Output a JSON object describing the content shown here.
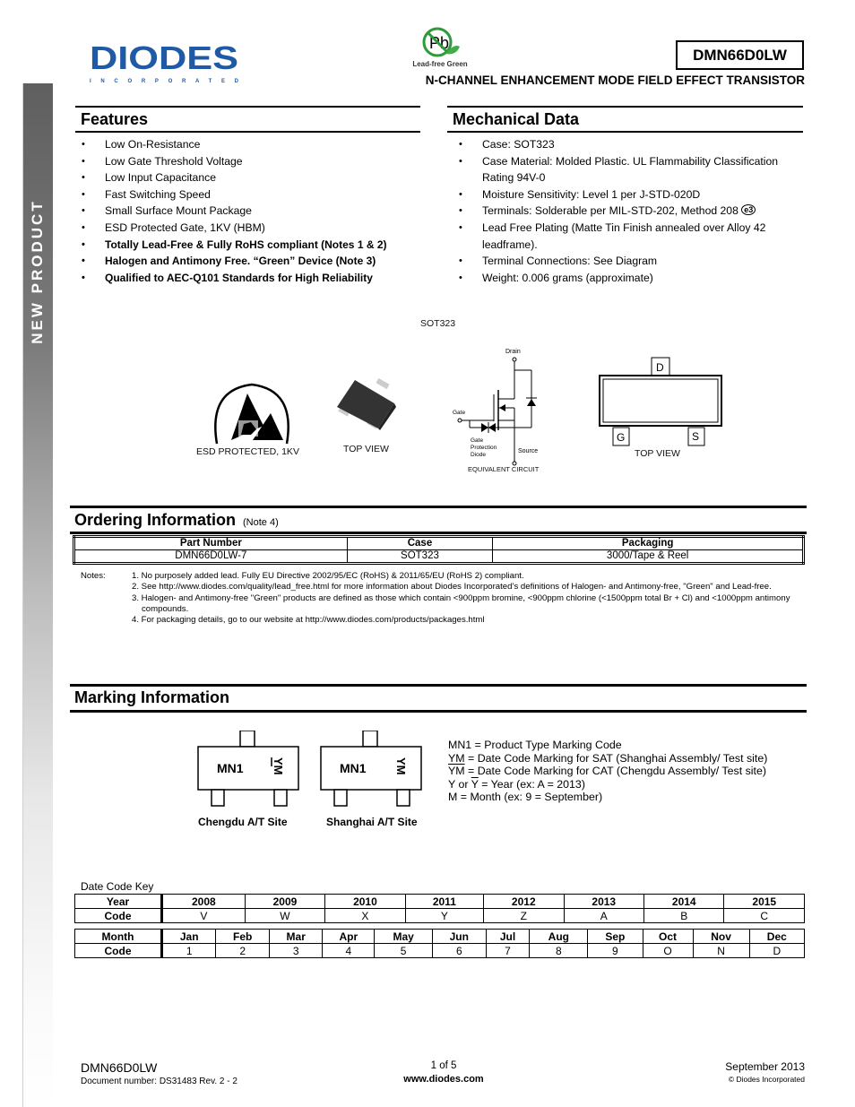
{
  "sidebar": {
    "label": "NEW PRODUCT"
  },
  "header": {
    "logo_text": "DIODES",
    "logo_subtext": "INCORPORATED",
    "leadfree_badge": "Lead-free Green",
    "leadfree_symbol": "Pb",
    "part_number": "DMN66D0LW",
    "device_title": "N-CHANNEL ENHANCEMENT MODE FIELD EFFECT TRANSISTOR"
  },
  "features": {
    "heading": "Features",
    "items": [
      {
        "text": "Low On-Resistance",
        "bold": false
      },
      {
        "text": "Low Gate Threshold Voltage",
        "bold": false
      },
      {
        "text": "Low Input Capacitance",
        "bold": false
      },
      {
        "text": "Fast Switching Speed",
        "bold": false
      },
      {
        "text": "Small Surface Mount Package",
        "bold": false
      },
      {
        "text": "ESD Protected Gate, 1KV (HBM)",
        "bold": false
      },
      {
        "text": "Totally Lead-Free & Fully RoHS compliant (Notes 1 & 2)",
        "bold": true
      },
      {
        "text": "Halogen and Antimony Free. “Green” Device (Note 3)",
        "bold": true
      },
      {
        "text": "Qualified to AEC-Q101 Standards for High Reliability",
        "bold": true
      }
    ]
  },
  "mechanical": {
    "heading": "Mechanical Data",
    "items": [
      "Case: SOT323",
      "Case Material: Molded Plastic. UL Flammability Classification Rating 94V-0",
      "Moisture Sensitivity:  Level 1 per J-STD-020D",
      "Terminals: Solderable per MIL-STD-202, Method 208",
      "Lead Free Plating (Matte Tin Finish annealed over Alloy 42 leadframe).",
      "Terminal Connections: See Diagram",
      "Weight: 0.006 grams (approximate)"
    ],
    "e3_mark": "e3"
  },
  "figures": {
    "package_label": "SOT323",
    "esd_label": "ESD PROTECTED, 1KV",
    "package_view_label": "TOP VIEW",
    "circuit": {
      "drain": "Drain",
      "gate": "Gate",
      "source": "Source",
      "diode_l1": "Gate",
      "diode_l2": "Protection",
      "diode_l3": "Diode",
      "caption": "EQUIVALENT CIRCUIT"
    },
    "pinout": {
      "d": "D",
      "g": "G",
      "s": "S",
      "caption": "TOP VIEW"
    }
  },
  "ordering": {
    "heading": "Ordering Information",
    "note_ref": "(Note 4)",
    "columns": [
      "Part Number",
      "Case",
      "Packaging"
    ],
    "rows": [
      [
        "DMN66D0LW-7",
        "SOT323",
        "3000/Tape & Reel"
      ]
    ]
  },
  "notes": {
    "label": "Notes:",
    "items": [
      "1. No purposely added lead. Fully EU Directive 2002/95/EC (RoHS) & 2011/65/EU (RoHS 2) compliant.",
      "2. See http://www.diodes.com/quality/lead_free.html for more information about Diodes Incorporated’s definitions of Halogen- and Antimony-free, \"Green\" and Lead-free.",
      "3. Halogen- and Antimony-free \"Green\" products are defined as those which contain <900ppm bromine, <900ppm chlorine (<1500ppm total Br + Cl) and <1000ppm antimony compounds.",
      "4. For packaging details, go to our website at http://www.diodes.com/products/packages.html"
    ]
  },
  "marking": {
    "heading": "Marking Information",
    "code": "MN1",
    "datecode": "YM",
    "sites": [
      "Chengdu A/T Site",
      "Shanghai A/T Site"
    ],
    "legend": {
      "l1": "MN1 = Product Type Marking Code",
      "l2": "YM = Date Code Marking for SAT (Shanghai Assembly/ Test site)",
      "l3_sym": "YM",
      "l3": " = Date Code Marking for CAT (Chengdu Assembly/ Test site)",
      "l4a": "Y or ",
      "l4_sym": "Y",
      "l4b": " = Year (ex: A = 2013)",
      "l5": "M = Month (ex: 9 = September)"
    }
  },
  "date_code": {
    "label": "Date Code Key",
    "year_header": "Year",
    "code_header": "Code",
    "years": [
      "2008",
      "2009",
      "2010",
      "2011",
      "2012",
      "2013",
      "2014",
      "2015"
    ],
    "year_codes": [
      "V",
      "W",
      "X",
      "Y",
      "Z",
      "A",
      "B",
      "C"
    ],
    "month_header": "Month",
    "months": [
      "Jan",
      "Feb",
      "Mar",
      "Apr",
      "May",
      "Jun",
      "Jul",
      "Aug",
      "Sep",
      "Oct",
      "Nov",
      "Dec"
    ],
    "month_codes": [
      "1",
      "2",
      "3",
      "4",
      "5",
      "6",
      "7",
      "8",
      "9",
      "O",
      "N",
      "D"
    ]
  },
  "footer": {
    "part": "DMN66D0LW",
    "doc_number": "Document number: DS31483 Rev. 2 - 2",
    "page": "1 of 5",
    "website": "www.diodes.com",
    "date": "September 2013",
    "copyright": "© Diodes Incorporated"
  },
  "colors": {
    "brand_blue": "#1f5aa6",
    "leadfree_green": "#2e9a3a"
  }
}
